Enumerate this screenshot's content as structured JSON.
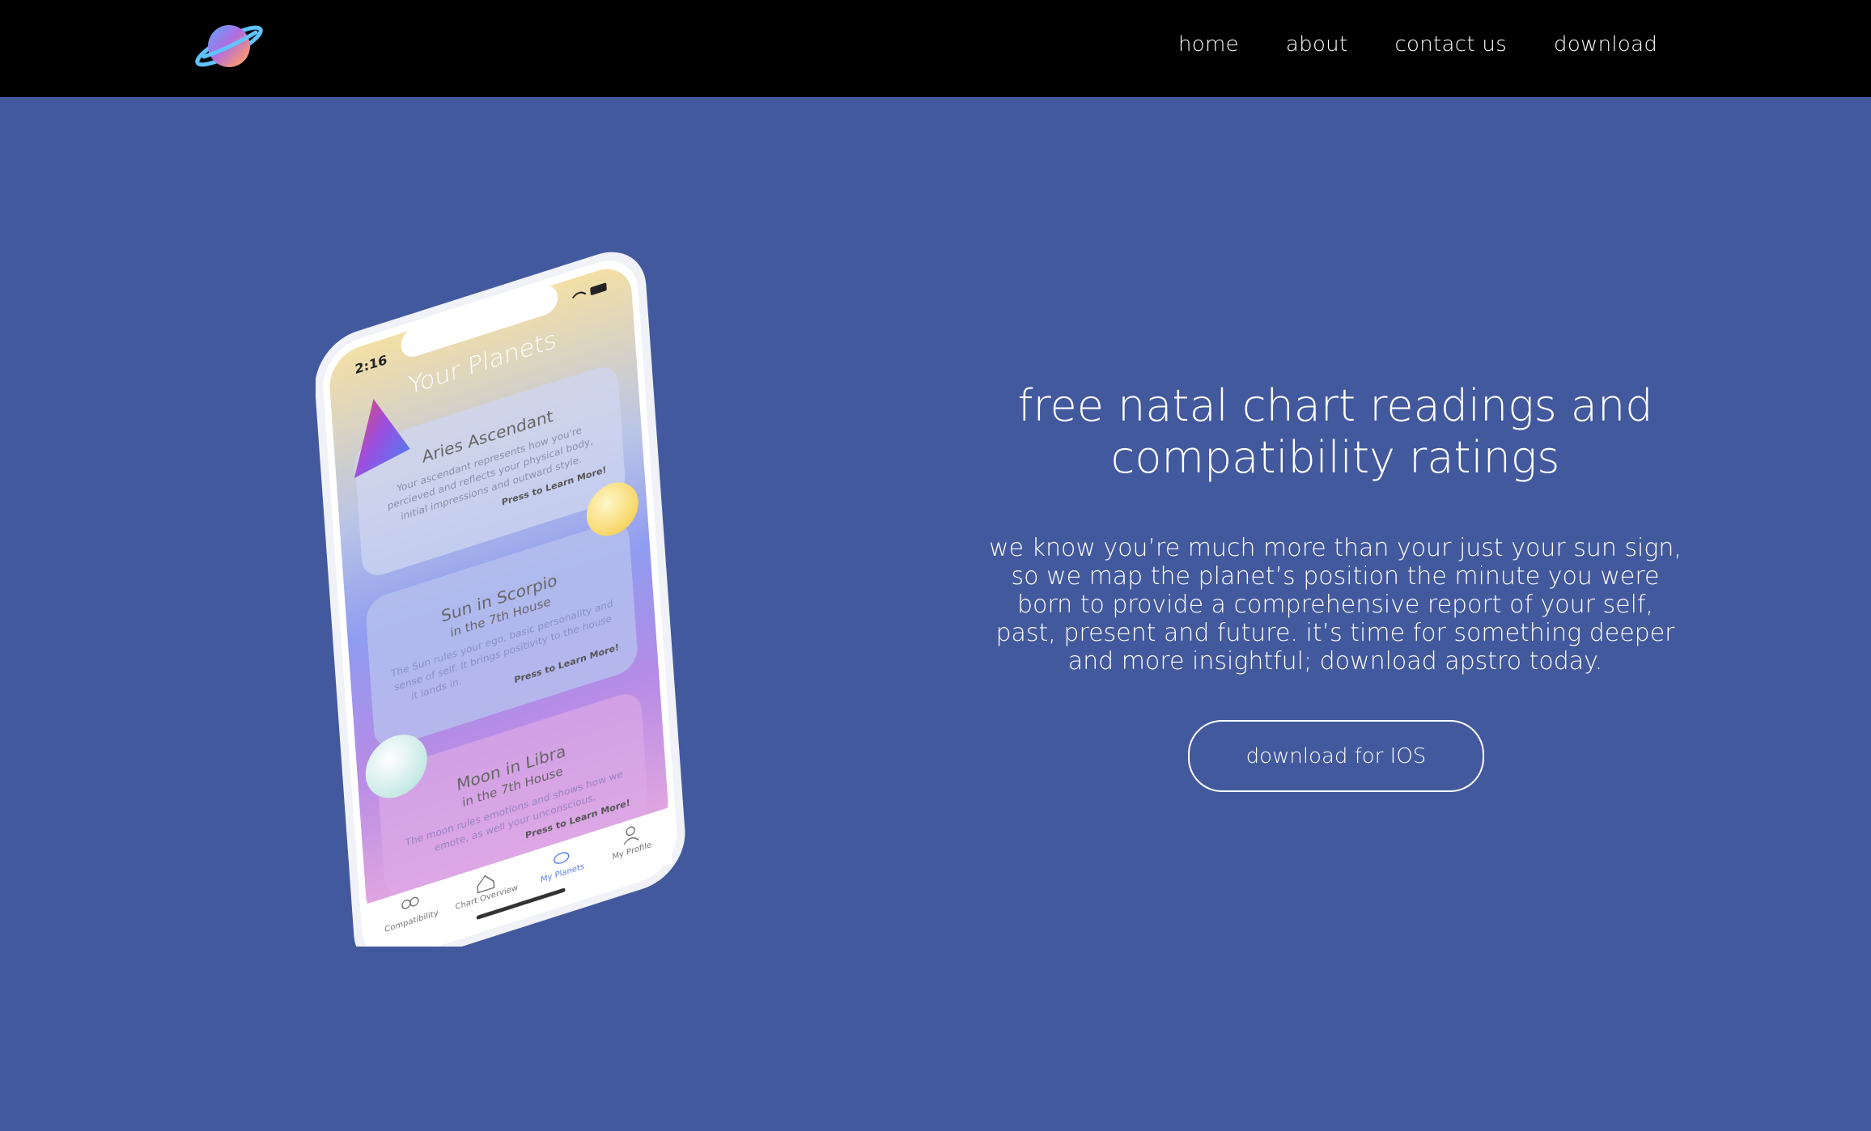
{
  "nav": {
    "logo_icon": "planet-ring-icon",
    "links": [
      {
        "label": "home"
      },
      {
        "label": "about"
      },
      {
        "label": "contact us"
      },
      {
        "label": "download"
      }
    ]
  },
  "phone": {
    "status_time": "2:16",
    "screen_title": "Your Planets",
    "cards": [
      {
        "title": "Aries Ascendant",
        "subtitle": "",
        "body": [
          "Your ascendant represents how you're",
          "percieved and reflects your physical body,",
          "initial impressions and outward style."
        ],
        "cta": "Press to Learn More!"
      },
      {
        "title": "Sun in Scorpio",
        "subtitle": "in the 7th House",
        "body": [
          "The Sun rules your ego, basic personality and",
          "sense of self. It brings positivity to the house",
          "it lands in."
        ],
        "cta": "Press to Learn More!"
      },
      {
        "title": "Moon in Libra",
        "subtitle": "in the 7th House",
        "body": [
          "The moon rules emotions and shows how we",
          "emote, as well your unconscious."
        ],
        "cta": "Press to Learn More!"
      }
    ],
    "tabs": [
      {
        "label": "Compatibility",
        "icon": "people-icon"
      },
      {
        "label": "Chart Overview",
        "icon": "home-icon"
      },
      {
        "label": "My Planets",
        "icon": "planet-icon"
      },
      {
        "label": "My Profile",
        "icon": "person-icon"
      }
    ]
  },
  "hero": {
    "title_line1": "free natal chart readings and",
    "title_line2": "compatibility ratings",
    "body": "we know you’re much more than your just your sun sign, so we map the planet’s position the minute you were born to provide a comprehensive report of your self, past, present and future. it’s time for something deeper and more insightful; download apstro today.",
    "cta_label": "download for IOS"
  },
  "colors": {
    "background": "#43599d",
    "navbar": "#000000",
    "text": "#ffffff",
    "tab_active": "#5b7ee6"
  }
}
